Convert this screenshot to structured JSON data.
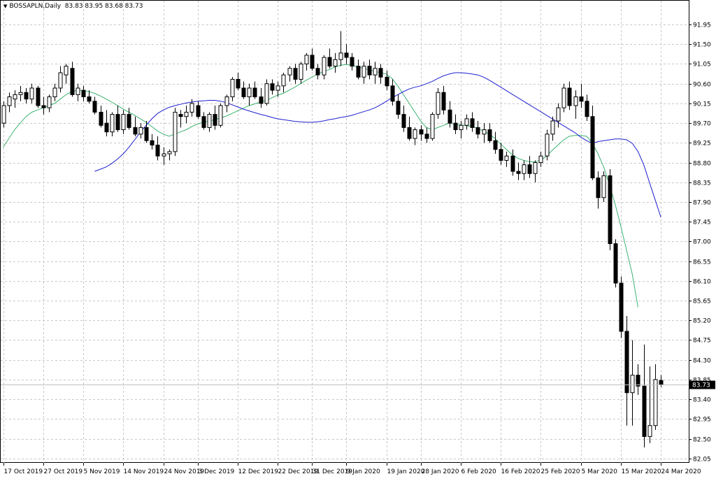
{
  "header": {
    "symbol_timeframe": "BOSSAPLN,Daily",
    "ohlc": "83.83 83.95 83.68 83.73"
  },
  "colors": {
    "background": "#ffffff",
    "grid": "#c8c8c8",
    "candle": "#000000",
    "ma_fast": "#3cb371",
    "ma_slow": "#1f1fd0",
    "current_price_line": "#c0c0c0",
    "price_label_bg": "#000000",
    "price_label_text": "#ffffff"
  },
  "chart_data": {
    "type": "candlestick",
    "title": "",
    "grid": true,
    "ylim": [
      81.95,
      92.35
    ],
    "yticks": [
      "91.95",
      "91.50",
      "91.05",
      "90.60",
      "90.15",
      "89.70",
      "89.25",
      "88.80",
      "88.35",
      "87.90",
      "87.45",
      "87.00",
      "86.55",
      "86.10",
      "85.65",
      "85.20",
      "84.75",
      "84.30",
      "83.85",
      "83.40",
      "82.95",
      "82.50",
      "82.05"
    ],
    "xticks": [
      {
        "label": "17 Oct 2019",
        "index": 0
      },
      {
        "label": "27 Oct 2019",
        "index": 7
      },
      {
        "label": "5 Nov 2019",
        "index": 14
      },
      {
        "label": "14 Nov 2019",
        "index": 21
      },
      {
        "label": "24 Nov 2019",
        "index": 28
      },
      {
        "label": "3 Dec 2019",
        "index": 34
      },
      {
        "label": "12 Dec 2019",
        "index": 41
      },
      {
        "label": "22 Dec 2019",
        "index": 48
      },
      {
        "label": "31 Dec 2019",
        "index": 54
      },
      {
        "label": "9 Jan 2020",
        "index": 60
      },
      {
        "label": "19 Jan 2020",
        "index": 67
      },
      {
        "label": "28 Jan 2020",
        "index": 73
      },
      {
        "label": "6 Feb 2020",
        "index": 80
      },
      {
        "label": "16 Feb 2020",
        "index": 87
      },
      {
        "label": "25 Feb 2020",
        "index": 94
      },
      {
        "label": "5 Mar 2020",
        "index": 101
      },
      {
        "label": "15 Mar 2020",
        "index": 108
      },
      {
        "label": "24 Mar 2020",
        "index": 115
      }
    ],
    "current_price": "83.73",
    "candles": [
      [
        89.7,
        90.2,
        89.6,
        90.1
      ],
      [
        90.1,
        90.4,
        89.95,
        90.3
      ],
      [
        90.25,
        90.45,
        90.05,
        90.35
      ],
      [
        90.35,
        90.55,
        90.2,
        90.4
      ],
      [
        90.4,
        90.5,
        90.15,
        90.25
      ],
      [
        90.25,
        90.6,
        90.15,
        90.5
      ],
      [
        90.5,
        90.55,
        90.05,
        90.1
      ],
      [
        90.1,
        90.3,
        89.9,
        90.05
      ],
      [
        90.05,
        90.35,
        89.95,
        90.3
      ],
      [
        90.3,
        90.6,
        90.2,
        90.5
      ],
      [
        90.5,
        91.0,
        90.4,
        90.85
      ],
      [
        90.8,
        91.05,
        90.6,
        91.0
      ],
      [
        90.95,
        91.1,
        90.3,
        90.35
      ],
      [
        90.35,
        90.6,
        90.2,
        90.5
      ],
      [
        90.45,
        90.55,
        90.2,
        90.3
      ],
      [
        90.3,
        90.45,
        90.15,
        90.2
      ],
      [
        90.2,
        90.3,
        89.9,
        89.95
      ],
      [
        89.95,
        90.1,
        89.6,
        89.65
      ],
      [
        89.7,
        90.0,
        89.4,
        89.5
      ],
      [
        89.5,
        89.95,
        89.4,
        89.9
      ],
      [
        89.9,
        90.1,
        89.5,
        89.55
      ],
      [
        89.55,
        90.0,
        89.45,
        89.9
      ],
      [
        89.9,
        90.05,
        89.55,
        89.6
      ],
      [
        89.6,
        89.85,
        89.4,
        89.45
      ],
      [
        89.45,
        89.7,
        89.35,
        89.6
      ],
      [
        89.6,
        89.75,
        89.25,
        89.3
      ],
      [
        89.3,
        89.45,
        89.1,
        89.2
      ],
      [
        89.2,
        89.4,
        88.85,
        88.95
      ],
      [
        88.95,
        89.15,
        88.75,
        89.0
      ],
      [
        89.0,
        89.1,
        88.85,
        89.05
      ],
      [
        89.05,
        90.05,
        88.95,
        89.95
      ],
      [
        89.9,
        90.0,
        89.6,
        89.85
      ],
      [
        89.85,
        90.1,
        89.7,
        89.95
      ],
      [
        89.95,
        90.25,
        89.85,
        90.15
      ],
      [
        90.1,
        90.2,
        89.8,
        89.85
      ],
      [
        89.85,
        89.95,
        89.55,
        89.6
      ],
      [
        89.6,
        89.95,
        89.5,
        89.9
      ],
      [
        89.9,
        90.1,
        89.55,
        89.65
      ],
      [
        89.65,
        90.15,
        89.6,
        90.1
      ],
      [
        90.1,
        90.35,
        89.95,
        90.3
      ],
      [
        90.3,
        90.75,
        90.2,
        90.7
      ],
      [
        90.7,
        90.85,
        90.45,
        90.5
      ],
      [
        90.5,
        90.65,
        90.25,
        90.3
      ],
      [
        90.3,
        90.6,
        90.1,
        90.5
      ],
      [
        90.5,
        90.65,
        90.25,
        90.3
      ],
      [
        90.3,
        90.5,
        90.05,
        90.15
      ],
      [
        90.15,
        90.7,
        90.1,
        90.6
      ],
      [
        90.6,
        90.7,
        90.35,
        90.45
      ],
      [
        90.45,
        90.65,
        90.3,
        90.55
      ],
      [
        90.55,
        90.85,
        90.4,
        90.8
      ],
      [
        90.8,
        91.0,
        90.65,
        90.95
      ],
      [
        90.95,
        91.05,
        90.6,
        90.7
      ],
      [
        90.7,
        91.1,
        90.6,
        91.05
      ],
      [
        91.05,
        91.3,
        90.9,
        91.25
      ],
      [
        91.25,
        91.4,
        90.9,
        90.95
      ],
      [
        90.95,
        91.05,
        90.7,
        90.8
      ],
      [
        90.8,
        91.25,
        90.7,
        91.2
      ],
      [
        91.2,
        91.4,
        90.95,
        91.0
      ],
      [
        91.0,
        91.3,
        90.85,
        91.15
      ],
      [
        91.15,
        91.8,
        91.0,
        91.3
      ],
      [
        91.3,
        91.5,
        91.05,
        91.2
      ],
      [
        91.2,
        91.3,
        90.9,
        91.0
      ],
      [
        91.0,
        91.15,
        90.7,
        90.75
      ],
      [
        90.75,
        91.1,
        90.6,
        91.0
      ],
      [
        91.0,
        91.15,
        90.7,
        90.8
      ],
      [
        90.8,
        91.1,
        90.6,
        90.95
      ],
      [
        90.95,
        91.05,
        90.6,
        90.75
      ],
      [
        90.75,
        90.9,
        90.45,
        90.55
      ],
      [
        90.55,
        90.7,
        90.1,
        90.2
      ],
      [
        90.2,
        90.35,
        89.8,
        89.9
      ],
      [
        89.9,
        90.1,
        89.5,
        89.6
      ],
      [
        89.6,
        89.85,
        89.3,
        89.35
      ],
      [
        89.35,
        89.6,
        89.2,
        89.55
      ],
      [
        89.55,
        89.65,
        89.3,
        89.45
      ],
      [
        89.45,
        89.6,
        89.25,
        89.35
      ],
      [
        89.35,
        89.95,
        89.3,
        89.9
      ],
      [
        89.9,
        90.5,
        89.8,
        90.4
      ],
      [
        90.4,
        90.55,
        89.9,
        90.0
      ],
      [
        90.0,
        90.2,
        89.6,
        89.7
      ],
      [
        89.7,
        89.9,
        89.45,
        89.55
      ],
      [
        89.55,
        89.75,
        89.35,
        89.65
      ],
      [
        89.65,
        89.9,
        89.55,
        89.8
      ],
      [
        89.8,
        89.95,
        89.5,
        89.6
      ],
      [
        89.6,
        89.75,
        89.35,
        89.45
      ],
      [
        89.45,
        89.7,
        89.25,
        89.55
      ],
      [
        89.55,
        89.7,
        89.25,
        89.3
      ],
      [
        89.3,
        89.5,
        89.0,
        89.1
      ],
      [
        89.1,
        89.25,
        88.75,
        88.85
      ],
      [
        88.85,
        89.05,
        88.7,
        88.95
      ],
      [
        88.95,
        89.1,
        88.5,
        88.6
      ],
      [
        88.6,
        88.8,
        88.4,
        88.55
      ],
      [
        88.55,
        88.85,
        88.4,
        88.75
      ],
      [
        88.75,
        88.95,
        88.45,
        88.55
      ],
      [
        88.55,
        88.85,
        88.35,
        88.8
      ],
      [
        88.8,
        89.05,
        88.7,
        88.95
      ],
      [
        88.95,
        89.55,
        88.85,
        89.45
      ],
      [
        89.45,
        89.85,
        89.3,
        89.75
      ],
      [
        89.75,
        90.15,
        89.6,
        90.05
      ],
      [
        90.05,
        90.6,
        89.95,
        90.5
      ],
      [
        90.5,
        90.65,
        90.0,
        90.1
      ],
      [
        90.1,
        90.45,
        89.8,
        90.3
      ],
      [
        90.3,
        90.6,
        90.05,
        90.2
      ],
      [
        90.2,
        90.35,
        89.75,
        89.85
      ],
      [
        89.85,
        90.1,
        88.4,
        88.45
      ],
      [
        88.45,
        88.6,
        87.75,
        88.0
      ],
      [
        88.0,
        88.6,
        87.9,
        88.5
      ],
      [
        88.5,
        88.65,
        86.8,
        86.95
      ],
      [
        86.95,
        87.05,
        85.95,
        86.05
      ],
      [
        86.05,
        86.2,
        84.8,
        84.95
      ],
      [
        84.95,
        85.3,
        82.8,
        83.55
      ],
      [
        83.55,
        84.75,
        82.8,
        83.95
      ],
      [
        83.95,
        84.2,
        83.5,
        83.7
      ],
      [
        83.7,
        84.65,
        82.3,
        82.55
      ],
      [
        82.55,
        84.15,
        82.4,
        82.8
      ],
      [
        82.8,
        84.2,
        82.7,
        83.85
      ],
      [
        83.83,
        83.95,
        83.68,
        83.73
      ]
    ],
    "series": [
      {
        "type": "line",
        "color": "#3cb371",
        "values": [
          89.15,
          89.35,
          89.55,
          89.7,
          89.85,
          89.95,
          90.0,
          90.05,
          90.1,
          90.15,
          90.25,
          90.35,
          90.42,
          90.45,
          90.44,
          90.42,
          90.38,
          90.32,
          90.25,
          90.18,
          90.1,
          90.02,
          89.95,
          89.88,
          89.8,
          89.72,
          89.62,
          89.52,
          89.45,
          89.4,
          89.45,
          89.5,
          89.55,
          89.62,
          89.68,
          89.72,
          89.75,
          89.78,
          89.82,
          89.86,
          89.92,
          89.98,
          90.04,
          90.1,
          90.14,
          90.18,
          90.22,
          90.28,
          90.34,
          90.38,
          90.45,
          90.52,
          90.6,
          90.68,
          90.75,
          90.82,
          90.88,
          90.92,
          90.98,
          91.02,
          91.04,
          91.02,
          90.98,
          90.95,
          90.92,
          90.88,
          90.85,
          90.82,
          90.72,
          90.55,
          90.35,
          90.15,
          89.95,
          89.75,
          89.6,
          89.55,
          89.6,
          89.65,
          89.7,
          89.68,
          89.66,
          89.64,
          89.62,
          89.58,
          89.52,
          89.45,
          89.35,
          89.22,
          89.1,
          88.98,
          88.9,
          88.85,
          88.82,
          88.82,
          88.85,
          88.95,
          89.08,
          89.2,
          89.32,
          89.4,
          89.42,
          89.42,
          89.4,
          89.25,
          89.0,
          88.7,
          88.3,
          87.85,
          87.35,
          86.8,
          86.25,
          85.5
        ],
        "start_index": 0
      },
      {
        "type": "line",
        "color": "#1f1fd0",
        "values": [
          88.6,
          88.65,
          88.7,
          88.78,
          88.88,
          89.0,
          89.15,
          89.32,
          89.5,
          89.65,
          89.8,
          89.92,
          90.0,
          90.06,
          90.1,
          90.13,
          90.16,
          90.18,
          90.2,
          90.21,
          90.22,
          90.22,
          90.2,
          90.17,
          90.12,
          90.07,
          90.02,
          89.98,
          89.94,
          89.9,
          89.87,
          89.83,
          89.8,
          89.78,
          89.76,
          89.74,
          89.73,
          89.72,
          89.72,
          89.73,
          89.75,
          89.78,
          89.8,
          89.83,
          89.85,
          89.88,
          89.92,
          89.96,
          90.0,
          90.05,
          90.12,
          90.2,
          90.28,
          90.35,
          90.42,
          90.48,
          90.52,
          90.55,
          90.6,
          90.65,
          90.72,
          90.78,
          90.82,
          90.85,
          90.85,
          90.84,
          90.82,
          90.8,
          90.75,
          90.68,
          90.6,
          90.52,
          90.44,
          90.36,
          90.28,
          90.2,
          90.12,
          90.04,
          89.96,
          89.88,
          89.8,
          89.72,
          89.64,
          89.56,
          89.48,
          89.38,
          89.3,
          89.24,
          89.28,
          89.3,
          89.32,
          89.34,
          89.34,
          89.32,
          89.24,
          89.05,
          88.75,
          88.35,
          87.95,
          87.55
        ],
        "start_index": 16
      }
    ]
  }
}
